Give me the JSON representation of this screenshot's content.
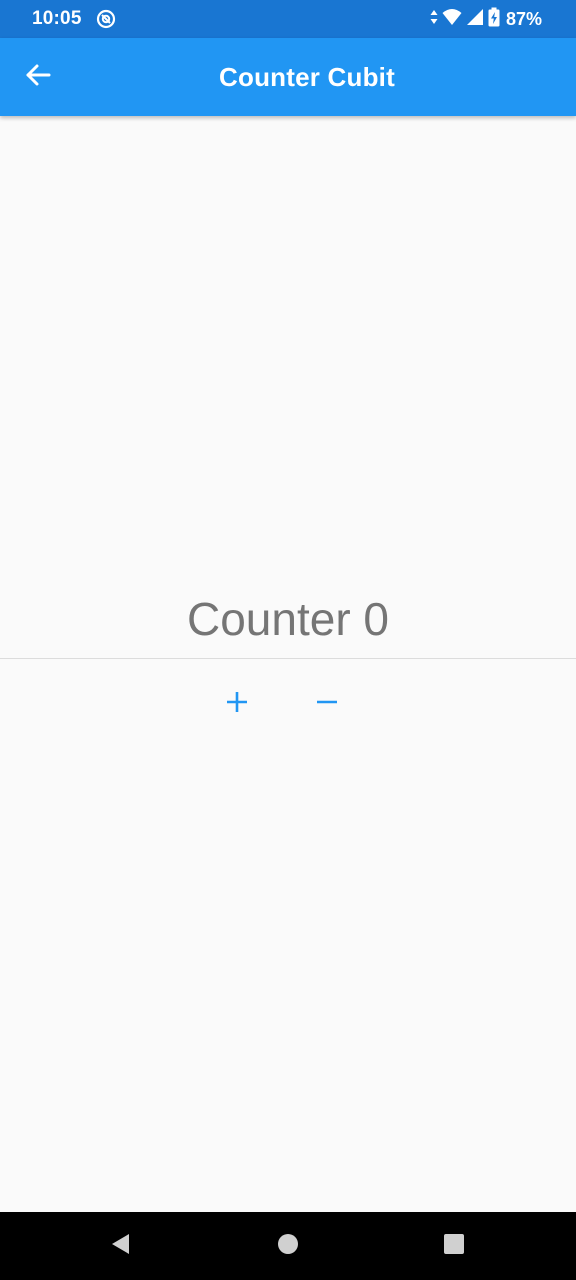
{
  "status_bar": {
    "time": "10:05",
    "battery": "87%",
    "icons": [
      "data-arrows-icon",
      "wifi-icon",
      "signal-icon",
      "battery-charging-icon"
    ],
    "background_color": "#1976d2"
  },
  "app_bar": {
    "title": "Counter Cubit",
    "back_icon": "arrow-back-icon",
    "background_color": "#2196f3"
  },
  "counter": {
    "label": "Counter 0"
  },
  "controls": {
    "increment_icon": "plus-icon",
    "decrement_icon": "minus-icon",
    "accent_color": "#2196f3"
  },
  "nav_bar": {
    "buttons": [
      "back-triangle-icon",
      "home-circle-icon",
      "recents-square-icon"
    ]
  }
}
